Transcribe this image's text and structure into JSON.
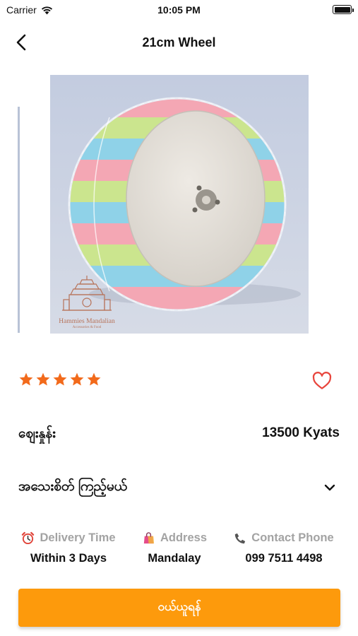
{
  "status_bar": {
    "carrier": "Carrier",
    "time": "10:05 PM"
  },
  "nav": {
    "title": "21cm Wheel",
    "back_icon": "chevron-left-icon"
  },
  "product": {
    "image_icon": "hamster-wheel-image",
    "logo": {
      "name": "Hammies Mandalian",
      "tagline": "Accessories & Food"
    },
    "rating": 5,
    "rating_max": 5,
    "star_color": "#f26a1b",
    "favorite_icon": "heart-outline-icon",
    "favorite_color": "#e8453c"
  },
  "price": {
    "label": "ဈေးနှုန်း",
    "value": "13500 Kyats"
  },
  "details": {
    "label": "အသေးစိတ် ကြည့်မယ်",
    "icon": "chevron-down-icon"
  },
  "info": [
    {
      "icon": "alarm-clock-icon",
      "label": "Delivery Time",
      "value": "Within 3 Days"
    },
    {
      "icon": "shopping-bag-icon",
      "label": "Address",
      "value": "Mandalay"
    },
    {
      "icon": "phone-icon",
      "label": "Contact Phone",
      "value": "099 7511 4498"
    }
  ],
  "buy_button": {
    "label": "ဝယ်ယူရန်",
    "color": "#fd9a0c"
  }
}
